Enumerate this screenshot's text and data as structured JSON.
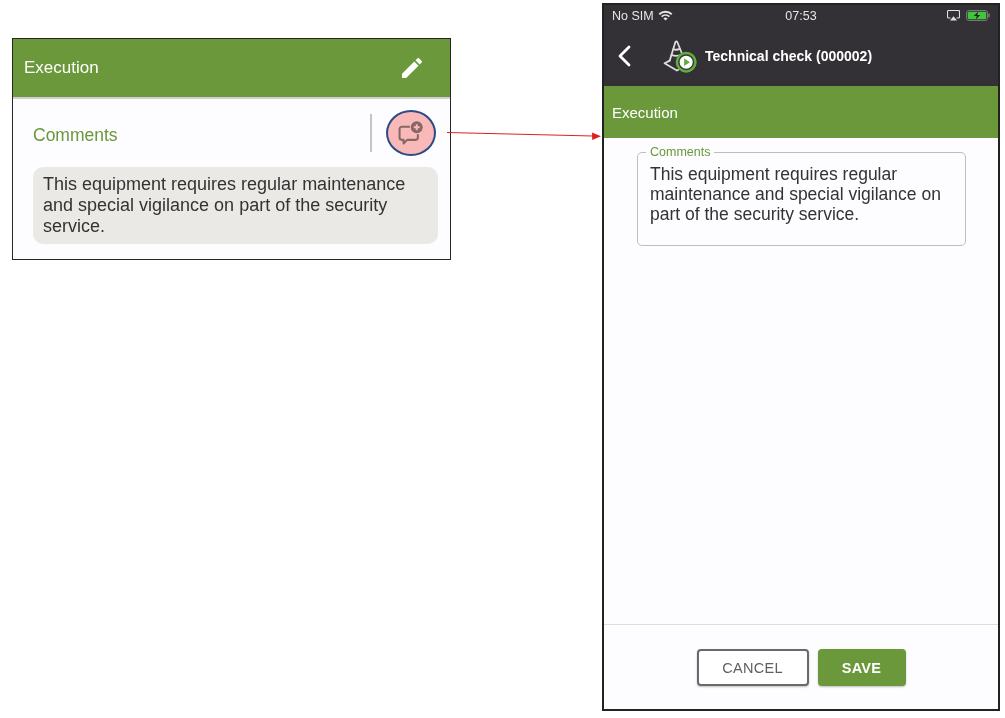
{
  "callout_card": {
    "header": {
      "title": "Execution"
    },
    "comments": {
      "label": "Comments",
      "value": "This equipment requires regular maintenance and special vigilance on part of the security service.",
      "add_button_highlighted": true
    }
  },
  "phone": {
    "status_bar": {
      "carrier": "No SIM",
      "time": "07:53"
    },
    "nav_bar": {
      "title": "Technical check (000002)"
    },
    "section": {
      "title": "Execution"
    },
    "comments_field": {
      "label": "Comments",
      "value": "This equipment requires regular maintenance and special vigilance on part of the security service."
    },
    "buttons": [
      {
        "label": "CANCEL",
        "kind": "outlined"
      },
      {
        "label": "SAVE",
        "kind": "filled"
      }
    ]
  }
}
